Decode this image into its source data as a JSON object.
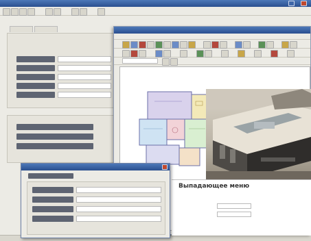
{
  "main_window": {
    "title": "",
    "tabs": [
      "",
      ""
    ],
    "fields": [
      {
        "label": "",
        "value": ""
      },
      {
        "label": "",
        "value": ""
      },
      {
        "label": "",
        "value": ""
      },
      {
        "label": "",
        "value": ""
      },
      {
        "label": "",
        "value": ""
      }
    ],
    "list_buttons": [
      "",
      "",
      ""
    ]
  },
  "cad_window": {
    "title": "",
    "drawing_view": "floor-plan",
    "render_view": "3d-kitchen-render",
    "info_panel": {
      "heading": "Выпадающее меню",
      "options": [
        "",
        ""
      ]
    }
  },
  "dialog": {
    "title": "",
    "subtitle": "",
    "fields": [
      {
        "label": "",
        "value": ""
      },
      {
        "label": "",
        "value": ""
      },
      {
        "label": "",
        "value": ""
      },
      {
        "label": "",
        "value": ""
      }
    ]
  },
  "statusbar": {
    "items": [
      "",
      ""
    ]
  },
  "colors": {
    "titlebar": "#2a4f8f",
    "label_bg": "#5e6472",
    "window_bg": "#ecebe5",
    "cad_canvas": "#ffffff"
  },
  "icons": [
    "minimize-icon",
    "maximize-icon",
    "close-icon",
    "toolbar-tool-icon"
  ]
}
